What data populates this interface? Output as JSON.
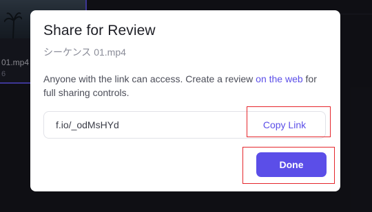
{
  "background": {
    "thumbnail_title": "01.mp4",
    "thumbnail_sub": "6"
  },
  "modal": {
    "title": "Share for Review",
    "filename": "シーケンス 01.mp4",
    "description_before": "Anyone with the link can access. Create a review ",
    "description_link": "on the web",
    "description_after": " for full sharing controls.",
    "link_value": "f.io/_odMsHYd",
    "copy_link_label": "Copy Link",
    "done_label": "Done"
  },
  "colors": {
    "accent": "#5b4ee8",
    "highlight": "#e5242a",
    "backdrop": "#131318"
  }
}
